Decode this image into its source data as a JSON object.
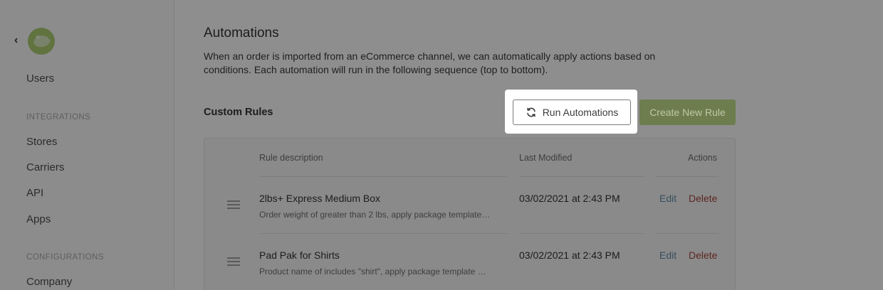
{
  "sidebar": {
    "items": [
      {
        "label": "Users"
      },
      {
        "label": "Stores"
      },
      {
        "label": "Carriers"
      },
      {
        "label": "API"
      },
      {
        "label": "Apps"
      },
      {
        "label": "Company"
      }
    ],
    "sections": {
      "integrations": "INTEGRATIONS",
      "configurations": "CONFIGURATIONS"
    }
  },
  "page": {
    "title": "Automations",
    "description": "When an order is imported from an eCommerce channel, we can automatically apply actions based on conditions. Each automation will run in the following sequence (top to bottom).",
    "section_title": "Custom Rules",
    "run_label": "Run Automations",
    "create_label": "Create New Rule"
  },
  "table": {
    "headers": {
      "description": "Rule description",
      "modified": "Last Modified",
      "actions": "Actions"
    },
    "rows": [
      {
        "title": "2lbs+ Express Medium Box",
        "subtitle": "Order weight of greater than 2 lbs, apply package template…",
        "modified": "03/02/2021 at 2:43 PM",
        "edit": "Edit",
        "delete": "Delete"
      },
      {
        "title": "Pad Pak for Shirts",
        "subtitle": "Product name of includes \"shirt\", apply package template …",
        "modified": "03/02/2021 at 2:43 PM",
        "edit": "Edit",
        "delete": "Delete"
      }
    ]
  },
  "colors": {
    "overlay": "#8e8e8e",
    "primary_button": "#6d7d4e",
    "edit_link": "#364f5f",
    "delete_link": "#5c2722"
  }
}
